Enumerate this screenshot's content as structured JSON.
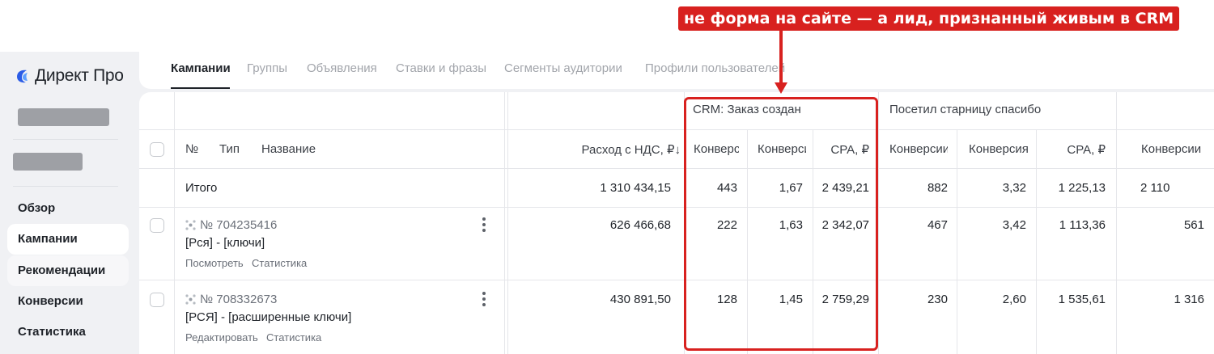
{
  "annotation": {
    "text": "не форма на сайте — а лид, признанный живым в CRM",
    "color": "#d8211f"
  },
  "sidebar": {
    "logo": "Директ Про",
    "items": [
      {
        "label": "Обзор"
      },
      {
        "label": "Кампании",
        "active": true
      },
      {
        "label": "Рекомендации"
      },
      {
        "label": "Конверсии"
      },
      {
        "label": "Статистика"
      }
    ]
  },
  "tabs": [
    {
      "label": "Кампании",
      "active": true
    },
    {
      "label": "Группы"
    },
    {
      "label": "Объявления"
    },
    {
      "label": "Ставки и фразы"
    },
    {
      "label": "Сегменты аудитории"
    },
    {
      "label": "Профили пользователей"
    }
  ],
  "table": {
    "group_headers": [
      "CRM: Заказ создан",
      "Посетил старницу спасибо"
    ],
    "columns": {
      "num": "№",
      "type": "Тип",
      "name": "Название",
      "spend": "Расход с НДС, ₽↓",
      "g1_conv": "Конверсии",
      "g1_rate": "Конверсия",
      "g1_cpa": "CPA, ₽",
      "g2_conv": "Конверсии",
      "g2_rate": "Конверсия",
      "g2_cpa": "CPA, ₽",
      "g3_conv": "Конверсии"
    },
    "total": {
      "label": "Итого",
      "spend": "1 310 434,15",
      "g1_conv": "443",
      "g1_rate": "1,67",
      "g1_cpa": "2 439,21",
      "g2_conv": "882",
      "g2_rate": "3,32",
      "g2_cpa": "1 225,13",
      "g3_conv": "2 110"
    },
    "rows": [
      {
        "id": "№ 704235416",
        "name": "[Рся] - [ключи]",
        "links": [
          "Посмотреть",
          "Статистика"
        ],
        "spend": "626 466,68",
        "g1_conv": "222",
        "g1_rate": "1,63",
        "g1_cpa": "2 342,07",
        "g2_conv": "467",
        "g2_rate": "3,42",
        "g2_cpa": "1 113,36",
        "g3_conv": "561"
      },
      {
        "id": "№ 708332673",
        "name": "[РСЯ] - [расширенные ключи]",
        "links": [
          "Редактировать",
          "Статистика"
        ],
        "spend": "430 891,50",
        "g1_conv": "128",
        "g1_rate": "1,45",
        "g1_cpa": "2 759,29",
        "g2_conv": "230",
        "g2_rate": "2,60",
        "g2_cpa": "1 535,61",
        "g3_conv": "1 316"
      }
    ]
  }
}
